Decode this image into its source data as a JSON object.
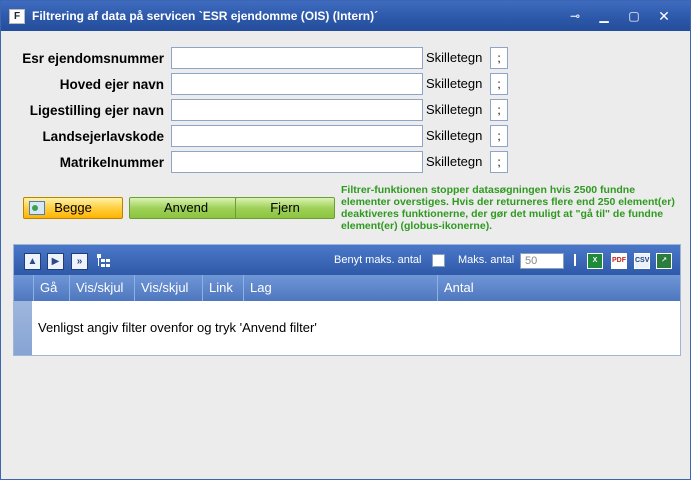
{
  "window": {
    "title": "Filtrering af data på servicen `ESR ejendomme (OIS) (Intern)´",
    "app_icon_letter": "F",
    "controls": [
      "pin-icon",
      "minimize-icon",
      "maximize-icon",
      "close-icon"
    ]
  },
  "form": {
    "rows": [
      {
        "label": "Esr ejendomsnummer",
        "value": "",
        "separator_label": "Skilletegn",
        "separator": ";"
      },
      {
        "label": "Hoved ejer navn",
        "value": "",
        "separator_label": "Skilletegn",
        "separator": ";"
      },
      {
        "label": "Ligestilling ejer navn",
        "value": "",
        "separator_label": "Skilletegn",
        "separator": ";"
      },
      {
        "label": "Landsejerlavskode",
        "value": "",
        "separator_label": "Skilletegn",
        "separator": ";"
      },
      {
        "label": "Matrikelnummer",
        "value": "",
        "separator_label": "Skilletegn",
        "separator": ";"
      }
    ]
  },
  "buttons": {
    "begge": "Begge",
    "anvend": "Anvend",
    "fjern": "Fjern"
  },
  "info_text": "Filtrer-funktionen stopper datasøgningen hvis 2500 fundne elementer overstiges. Hvis der returneres flere end 250 element(er) deaktiveres funktionerne, der gør det muligt at \"gå til\" de fundne element(er) (globus-ikonerne).",
  "grid": {
    "toolbar": {
      "use_max_label": "Benyt maks. antal",
      "max_label": "Maks. antal",
      "max_value": "50",
      "export_icons": [
        "excel-icon",
        "pdf-icon",
        "csv-icon",
        "export-icon"
      ]
    },
    "columns": [
      "Gå",
      "Vis/skjul",
      "Vis/skjul",
      "Link",
      "Lag",
      "Antal"
    ],
    "empty_message": "Venligst angiv filter ovenfor og tryk 'Anvend filter'"
  },
  "colors": {
    "titlebar": "#2c57a8",
    "info_text": "#2e9a1f",
    "grid_header": "#4f77bf"
  }
}
